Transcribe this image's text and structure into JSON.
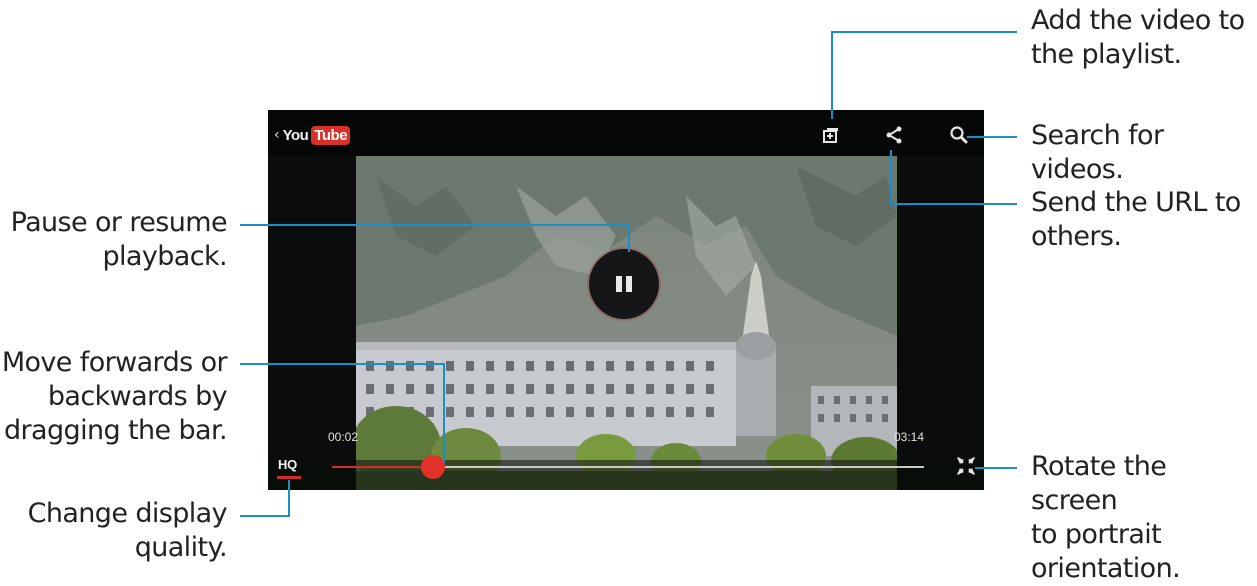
{
  "player": {
    "logo_you": "You",
    "logo_tube": "Tube",
    "current_time": "00:02",
    "total_time": "03:14",
    "progress_fraction": 0.17,
    "quality_label": "HQ",
    "icons": {
      "back": "chevron-left-icon",
      "playlist": "add-to-playlist-icon",
      "share": "share-icon",
      "search": "search-icon",
      "pause": "pause-icon",
      "rotate": "rotate-screen-icon"
    },
    "colors": {
      "accent": "#d32d28",
      "callout_line": "#1a8ec8"
    }
  },
  "callouts": {
    "add_playlist": "Add the video to\nthe playlist.",
    "search": "Search for videos.",
    "send_url": "Send the URL to\nothers.",
    "rotate": "Rotate the screen\nto portrait\norientation.",
    "pause": "Pause or resume\nplayback.",
    "move": "Move forwards or\nbackwards by\ndragging the bar.",
    "quality": "Change display\nquality."
  }
}
